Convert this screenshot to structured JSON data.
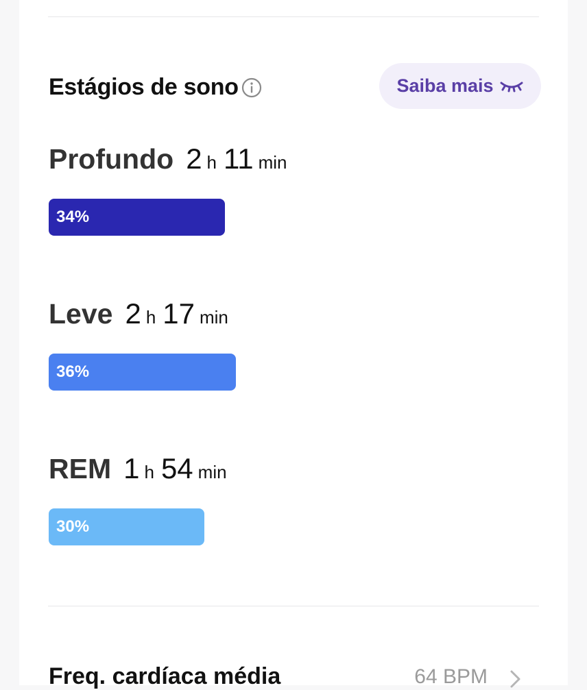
{
  "sleep_stages": {
    "title": "Estágios de sono",
    "learn_more_label": "Saiba mais",
    "stages": [
      {
        "name": "Profundo",
        "hours": "2",
        "hours_unit": "h",
        "minutes": "11",
        "minutes_unit": "min",
        "percent_label": "34%",
        "percent": 34,
        "color": "#2a27b0"
      },
      {
        "name": "Leve",
        "hours": "2",
        "hours_unit": "h",
        "minutes": "17",
        "minutes_unit": "min",
        "percent_label": "36%",
        "percent": 36,
        "color": "#4a80f0"
      },
      {
        "name": "REM",
        "hours": "1",
        "hours_unit": "h",
        "minutes": "54",
        "minutes_unit": "min",
        "percent_label": "30%",
        "percent": 30,
        "color": "#6bb9f7"
      }
    ]
  },
  "heart_rate": {
    "label": "Freq. cardíaca média",
    "value": "64 BPM"
  },
  "colors": {
    "accent": "#5a3fa6",
    "button_bg": "#f2effa"
  }
}
